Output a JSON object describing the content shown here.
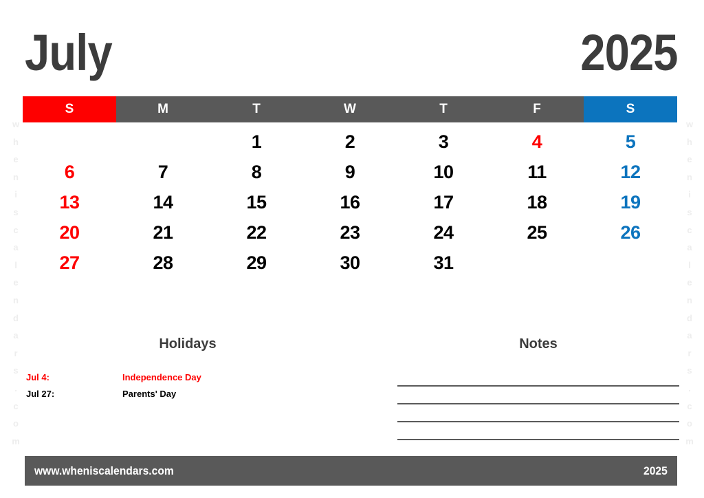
{
  "colors": {
    "sunday": "#fe0000",
    "saturday": "#0c74be",
    "weekday_header": "#595959",
    "title": "#3c3c3c",
    "weekday_date": "#000000",
    "watermark": "#ededed",
    "note_line": "#5a5a5a"
  },
  "header": {
    "month": "July",
    "year": "2025"
  },
  "weekdays": [
    {
      "label": "S",
      "kind": "sun"
    },
    {
      "label": "M",
      "kind": "weekday"
    },
    {
      "label": "T",
      "kind": "weekday"
    },
    {
      "label": "W",
      "kind": "weekday"
    },
    {
      "label": "T",
      "kind": "weekday"
    },
    {
      "label": "F",
      "kind": "weekday"
    },
    {
      "label": "S",
      "kind": "sat"
    }
  ],
  "weeks": [
    [
      {
        "day": "",
        "kind": "empty"
      },
      {
        "day": "",
        "kind": "empty"
      },
      {
        "day": "1",
        "kind": "weekday"
      },
      {
        "day": "2",
        "kind": "weekday"
      },
      {
        "day": "3",
        "kind": "weekday"
      },
      {
        "day": "4",
        "kind": "holiday"
      },
      {
        "day": "5",
        "kind": "sat"
      }
    ],
    [
      {
        "day": "6",
        "kind": "sun"
      },
      {
        "day": "7",
        "kind": "weekday"
      },
      {
        "day": "8",
        "kind": "weekday"
      },
      {
        "day": "9",
        "kind": "weekday"
      },
      {
        "day": "10",
        "kind": "weekday"
      },
      {
        "day": "11",
        "kind": "weekday"
      },
      {
        "day": "12",
        "kind": "sat"
      }
    ],
    [
      {
        "day": "13",
        "kind": "sun"
      },
      {
        "day": "14",
        "kind": "weekday"
      },
      {
        "day": "15",
        "kind": "weekday"
      },
      {
        "day": "16",
        "kind": "weekday"
      },
      {
        "day": "17",
        "kind": "weekday"
      },
      {
        "day": "18",
        "kind": "weekday"
      },
      {
        "day": "19",
        "kind": "sat"
      }
    ],
    [
      {
        "day": "20",
        "kind": "sun"
      },
      {
        "day": "21",
        "kind": "weekday"
      },
      {
        "day": "22",
        "kind": "weekday"
      },
      {
        "day": "23",
        "kind": "weekday"
      },
      {
        "day": "24",
        "kind": "weekday"
      },
      {
        "day": "25",
        "kind": "weekday"
      },
      {
        "day": "26",
        "kind": "sat"
      }
    ],
    [
      {
        "day": "27",
        "kind": "sun"
      },
      {
        "day": "28",
        "kind": "weekday"
      },
      {
        "day": "29",
        "kind": "weekday"
      },
      {
        "day": "30",
        "kind": "weekday"
      },
      {
        "day": "31",
        "kind": "weekday"
      },
      {
        "day": "",
        "kind": "empty"
      },
      {
        "day": "",
        "kind": "empty"
      }
    ]
  ],
  "holidays": {
    "heading": "Holidays",
    "items": [
      {
        "date": "Jul 4:",
        "name": "Independence Day",
        "style": "red"
      },
      {
        "date": "Jul 27:",
        "name": "Parents' Day",
        "style": "dark"
      }
    ]
  },
  "notes": {
    "heading": "Notes",
    "line_count": 4
  },
  "footer": {
    "url": "www.wheniscalendars.com",
    "year": "2025"
  },
  "watermark": {
    "text": "wheniscalendars.com"
  }
}
